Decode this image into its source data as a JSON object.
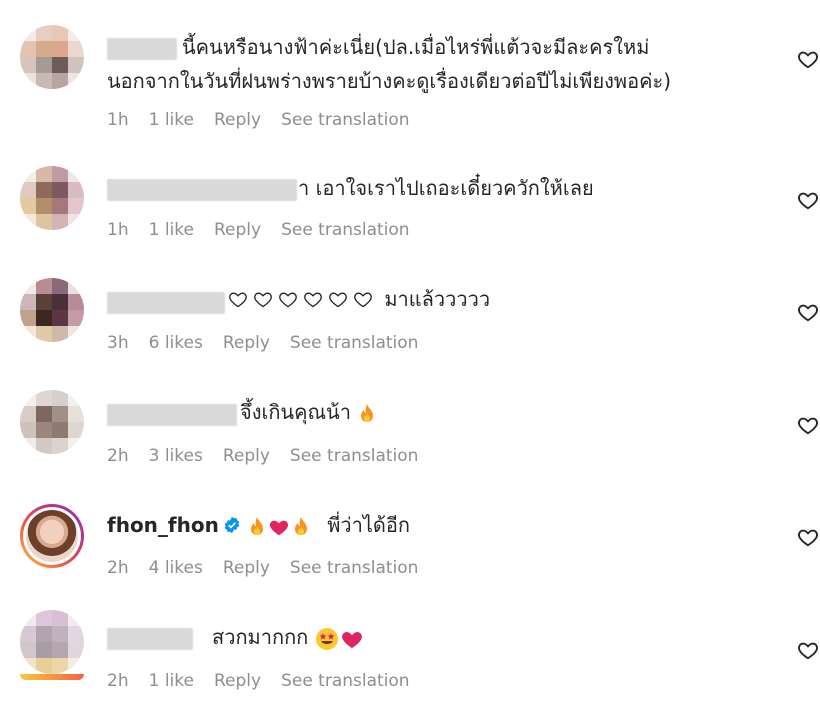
{
  "comments": [
    {
      "text_line1": "นี้คนหรือนางฟ้าค่ะเนี่ย(ปล.เมื่อไหร่พี่แต้วจะมีละครใหม่",
      "text_line2": "นอกจากในวันที่ฝนพร่างพรายบ้างคะดูเรื่องเดียวต่อปีไม่เพียงพอค่ะ)",
      "time": "1h",
      "likes": "1 like",
      "reply": "Reply",
      "translate": "See translation"
    },
    {
      "text": "า เอาใจเราไปเถอะเดี๋ยวควักให้เลย",
      "time": "1h",
      "likes": "1 like",
      "reply": "Reply",
      "translate": "See translation"
    },
    {
      "text": "มาแล้ววววว",
      "time": "3h",
      "likes": "6 likes",
      "reply": "Reply",
      "translate": "See translation"
    },
    {
      "text": "จึ้งเกินคุณน้า",
      "time": "2h",
      "likes": "3 likes",
      "reply": "Reply",
      "translate": "See translation"
    },
    {
      "username": "fhon_fhon",
      "text": "พี่ว่าได้อีก",
      "time": "2h",
      "likes": "4 likes",
      "reply": "Reply",
      "translate": "See translation"
    },
    {
      "text": "สวกมากกก",
      "time": "2h",
      "likes": "1 like",
      "reply": "Reply",
      "translate": "See translation"
    }
  ],
  "icons": {
    "like": "heart-outline-icon",
    "verified": "verified-badge-icon",
    "fire": "fire-emoji",
    "red_heart": "red-heart-emoji",
    "star_eyes": "star-struck-emoji"
  },
  "colors": {
    "text": "#262626",
    "meta": "#8e8e8e",
    "verified": "#0095f6",
    "red_heart": "#e0245e"
  }
}
